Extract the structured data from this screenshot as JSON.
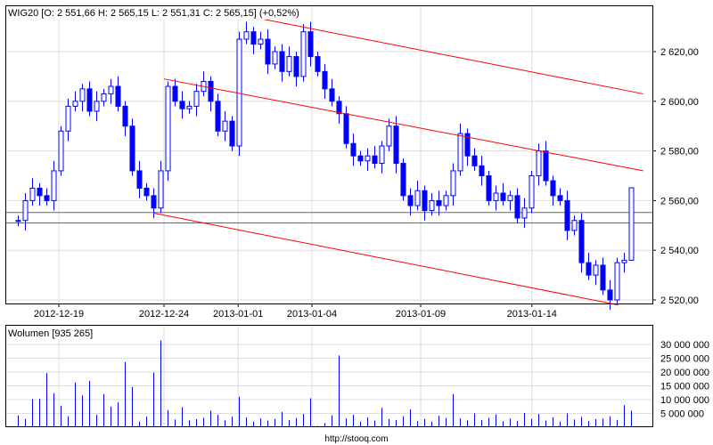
{
  "chart_data": [
    {
      "type": "candlestick",
      "title": "WIG20 [O: 2 551,66  H: 2 565,15  L: 2 551,31  C: 2 565,15] (+0,52%)",
      "ylim": [
        2515,
        2635
      ],
      "yticks": [
        2520,
        2540,
        2560,
        2580,
        2600,
        2620
      ],
      "ytick_labels": [
        "2 520,00",
        "2 540,00",
        "2 560,00",
        "2 580,00",
        "2 600,00",
        "2 620,00"
      ],
      "xticks": [
        {
          "label": "2012-12-19",
          "index": 5.75
        },
        {
          "label": "2012-12-24",
          "index": 20.5
        },
        {
          "label": "2013-01-01",
          "index": 30.9
        },
        {
          "label": "2013-01-04",
          "index": 41.25
        },
        {
          "label": "2013-01-09",
          "index": 56.5
        },
        {
          "label": "2013-01-14",
          "index": 72.1
        }
      ],
      "first_open": 2551.66,
      "last_low": 2551.31,
      "close": [
        2552,
        2560,
        2565,
        2562,
        2560,
        2572,
        2588,
        2598,
        2600,
        2605,
        2596,
        2600,
        2603,
        2606,
        2598,
        2590,
        2572,
        2565,
        2562,
        2557,
        2572,
        2606,
        2600,
        2597,
        2598,
        2604,
        2608,
        2600,
        2588,
        2592,
        2582,
        2625,
        2628,
        2623,
        2625,
        2615,
        2620,
        2612,
        2618,
        2610,
        2628,
        2618,
        2612,
        2605,
        2600,
        2595,
        2583,
        2578,
        2576,
        2578,
        2575,
        2582,
        2590,
        2575,
        2562,
        2558,
        2564,
        2556,
        2560,
        2558,
        2562,
        2572,
        2587,
        2578,
        2574,
        2570,
        2560,
        2563,
        2560,
        2562,
        2553,
        2557,
        2570,
        2580,
        2568,
        2562,
        2560,
        2548,
        2552,
        2535,
        2530,
        2534,
        2524,
        2520,
        2535,
        2536,
        2565.15
      ],
      "horizontal_levels": [
        2555.2,
        2551.0
      ],
      "trend_channels": [
        {
          "from": {
            "index": 31,
            "price": 2635
          },
          "to": {
            "index": 87.7,
            "price": 2603
          }
        },
        {
          "from": {
            "index": 20.5,
            "price": 2609
          },
          "to": {
            "index": 87.7,
            "price": 2572
          }
        },
        {
          "from": {
            "index": 19,
            "price": 2555
          },
          "to": {
            "index": 84.2,
            "price": 2518
          }
        }
      ],
      "colors": {
        "candle": "#0000ff",
        "channel": "#ff0000",
        "level": "#666666",
        "grid": "#dddddd"
      }
    },
    {
      "type": "bar",
      "title": "Wolumen [935 265]",
      "ylim": [
        0,
        32000000
      ],
      "yticks": [
        5000000,
        10000000,
        15000000,
        20000000,
        25000000,
        30000000
      ],
      "ytick_labels": [
        "5 000 000",
        "10 000 000",
        "15 000 000",
        "20 000 000",
        "25 000 000",
        "30 000 000"
      ],
      "values": [
        4.2,
        3.0,
        10.2,
        10.3,
        19.6,
        12.3,
        7.8,
        4.0,
        16.2,
        11.5,
        16.8,
        4.5,
        12.0,
        7.5,
        9.0,
        23.6,
        14.5,
        2.0,
        3.8,
        19.8,
        31.5,
        6.2,
        2.8,
        7.2,
        2.5,
        2.9,
        3.4,
        6.0,
        4.5,
        2.5,
        3.8,
        11.0,
        3.5,
        2.0,
        3.2,
        2.4,
        3.0,
        5.5,
        2.6,
        3.3,
        4.8,
        10.5,
        0.5,
        1.5,
        4.3,
        26.0,
        3.2,
        4.5,
        2.0,
        3.5,
        2.4,
        7.0,
        3.0,
        2.6,
        4.0,
        6.5,
        2.2,
        3.0,
        2.0,
        4.1,
        3.3,
        12.0,
        3.2,
        2.5,
        5.0,
        2.6,
        3.4,
        4.6,
        2.1,
        3.1,
        2.3,
        5.2,
        3.0,
        4.8,
        2.4,
        3.6,
        2.0,
        5.0,
        2.8,
        3.7,
        2.2,
        2.9,
        3.1,
        4.0,
        2.6,
        8.0,
        6.0
      ],
      "value_unit": "million shares"
    }
  ],
  "footer": {
    "url": "http://stooq.com"
  }
}
